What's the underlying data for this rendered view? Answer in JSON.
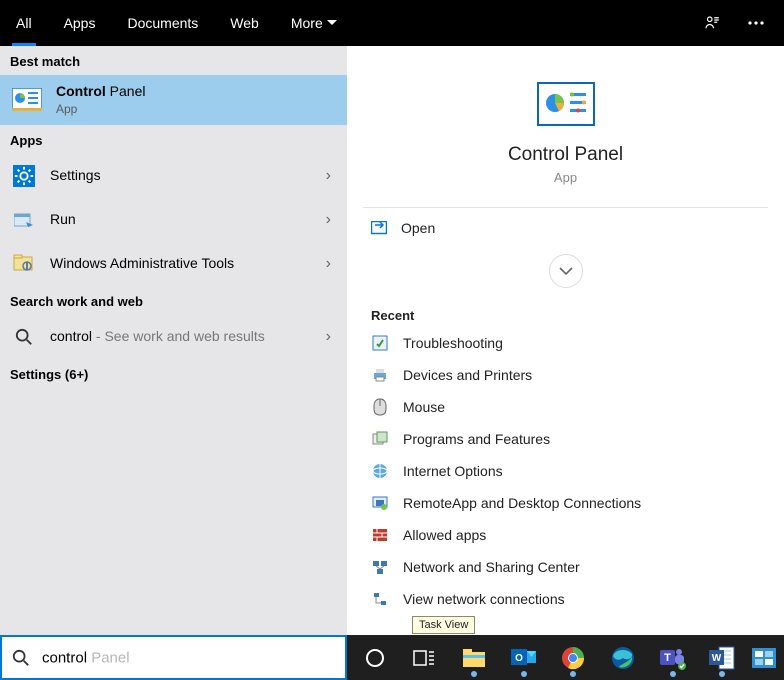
{
  "topBar": {
    "tabs": [
      "All",
      "Apps",
      "Documents",
      "Web",
      "More"
    ]
  },
  "left": {
    "bestMatchHeader": "Best match",
    "bestMatch": {
      "titleBold": "Control",
      "titleRest": " Panel",
      "sub": "App"
    },
    "appsHeader": "Apps",
    "apps": [
      {
        "label": "Settings"
      },
      {
        "label": "Run"
      },
      {
        "label": "Windows Administrative Tools"
      }
    ],
    "workWebHeader": "Search work and web",
    "workWeb": {
      "label": "control",
      "suffix": " - See work and web results"
    },
    "settingsMore": "Settings (6+)"
  },
  "right": {
    "title": "Control Panel",
    "sub": "App",
    "openLabel": "Open",
    "recentHeader": "Recent",
    "recent": [
      "Troubleshooting",
      "Devices and Printers",
      "Mouse",
      "Programs and Features",
      "Internet Options",
      "RemoteApp and Desktop Connections",
      "Allowed apps",
      "Network and Sharing Center",
      "View network connections"
    ]
  },
  "search": {
    "typed": "control",
    "ghost": " Panel"
  },
  "tooltip": "Task View"
}
